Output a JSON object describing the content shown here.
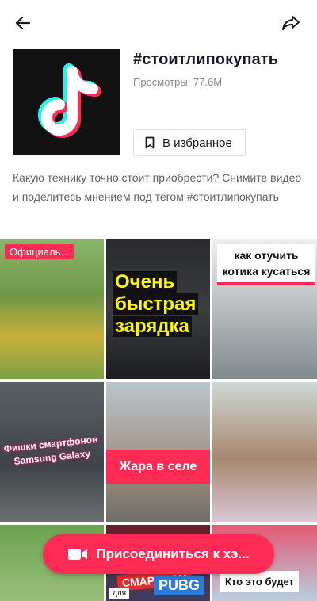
{
  "header": {
    "back_icon": "arrow-left-icon",
    "share_icon": "share-arrow-icon"
  },
  "hashtag": {
    "title": "#стоитлипокупать",
    "views": "Просмотры: 77.6M",
    "favorite_label": "В избранное",
    "description": "Какую технику точно стоит приобрести? Снимите видео и поделитесь мнением под тегом #стоитлипокупать"
  },
  "videos": [
    {
      "overlay": "Официаль..."
    },
    {
      "overlay": "Очень быстрая зарядка"
    },
    {
      "overlay": "как отучить котика кусаться"
    },
    {
      "overlay": "Фишки смартфонов Samsung Galaxy"
    },
    {
      "overlay": "Жара в селе"
    },
    {
      "overlay": ""
    },
    {
      "overlay": ""
    },
    {
      "overlay_red": "СМАРТФОН",
      "overlay_blue": "PUBG",
      "overlay_small": "для"
    },
    {
      "overlay": "Кто это будет"
    }
  ],
  "join_button": {
    "label": "Присоединиться к хэ...",
    "icon": "video-camera-icon"
  },
  "colors": {
    "accent": "#fe2c55",
    "text": "#161823",
    "muted": "#8a8b91"
  }
}
